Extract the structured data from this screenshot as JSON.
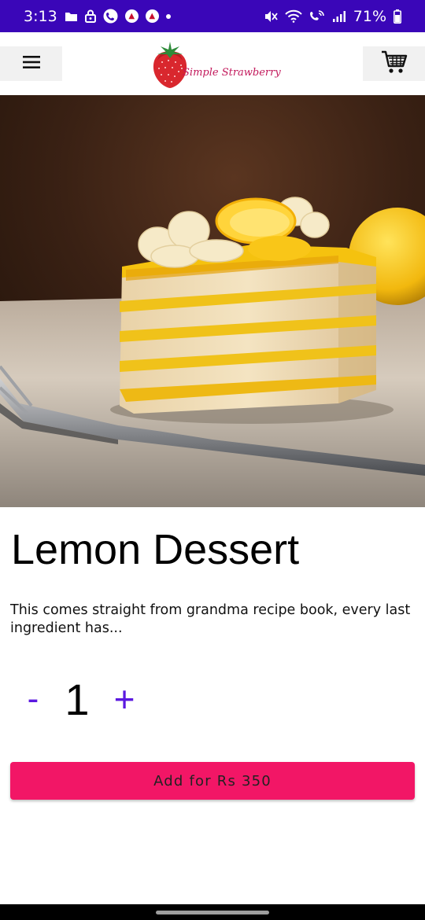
{
  "status_bar": {
    "time": "3:13",
    "battery": "71%",
    "icons": [
      "folder-icon",
      "lock-icon",
      "phone-call-icon",
      "notification-app-icon",
      "notification-app-icon",
      "dot-icon",
      "mute-icon",
      "wifi-icon",
      "volte-call-icon",
      "signal-icon",
      "battery-icon"
    ]
  },
  "app_bar": {
    "menu_icon": "hamburger-menu-icon",
    "logo_text": "Simple Strawberry",
    "cart_icon": "shopping-cart-icon"
  },
  "hero": {
    "image": "lemon-layer-cake-photo"
  },
  "product": {
    "title": "Lemon Dessert",
    "description": "This comes straight from grandma recipe book, every last ingredient has...",
    "quantity": {
      "minus_label": "-",
      "value": "1",
      "plus_label": "+"
    },
    "add_button_label": "Add for Rs 350"
  },
  "colors": {
    "status_bar": "#3a06b8",
    "accent_purple": "#5b19e0",
    "add_button": "#f21666",
    "icon_button_bg": "#f1f1f1"
  }
}
